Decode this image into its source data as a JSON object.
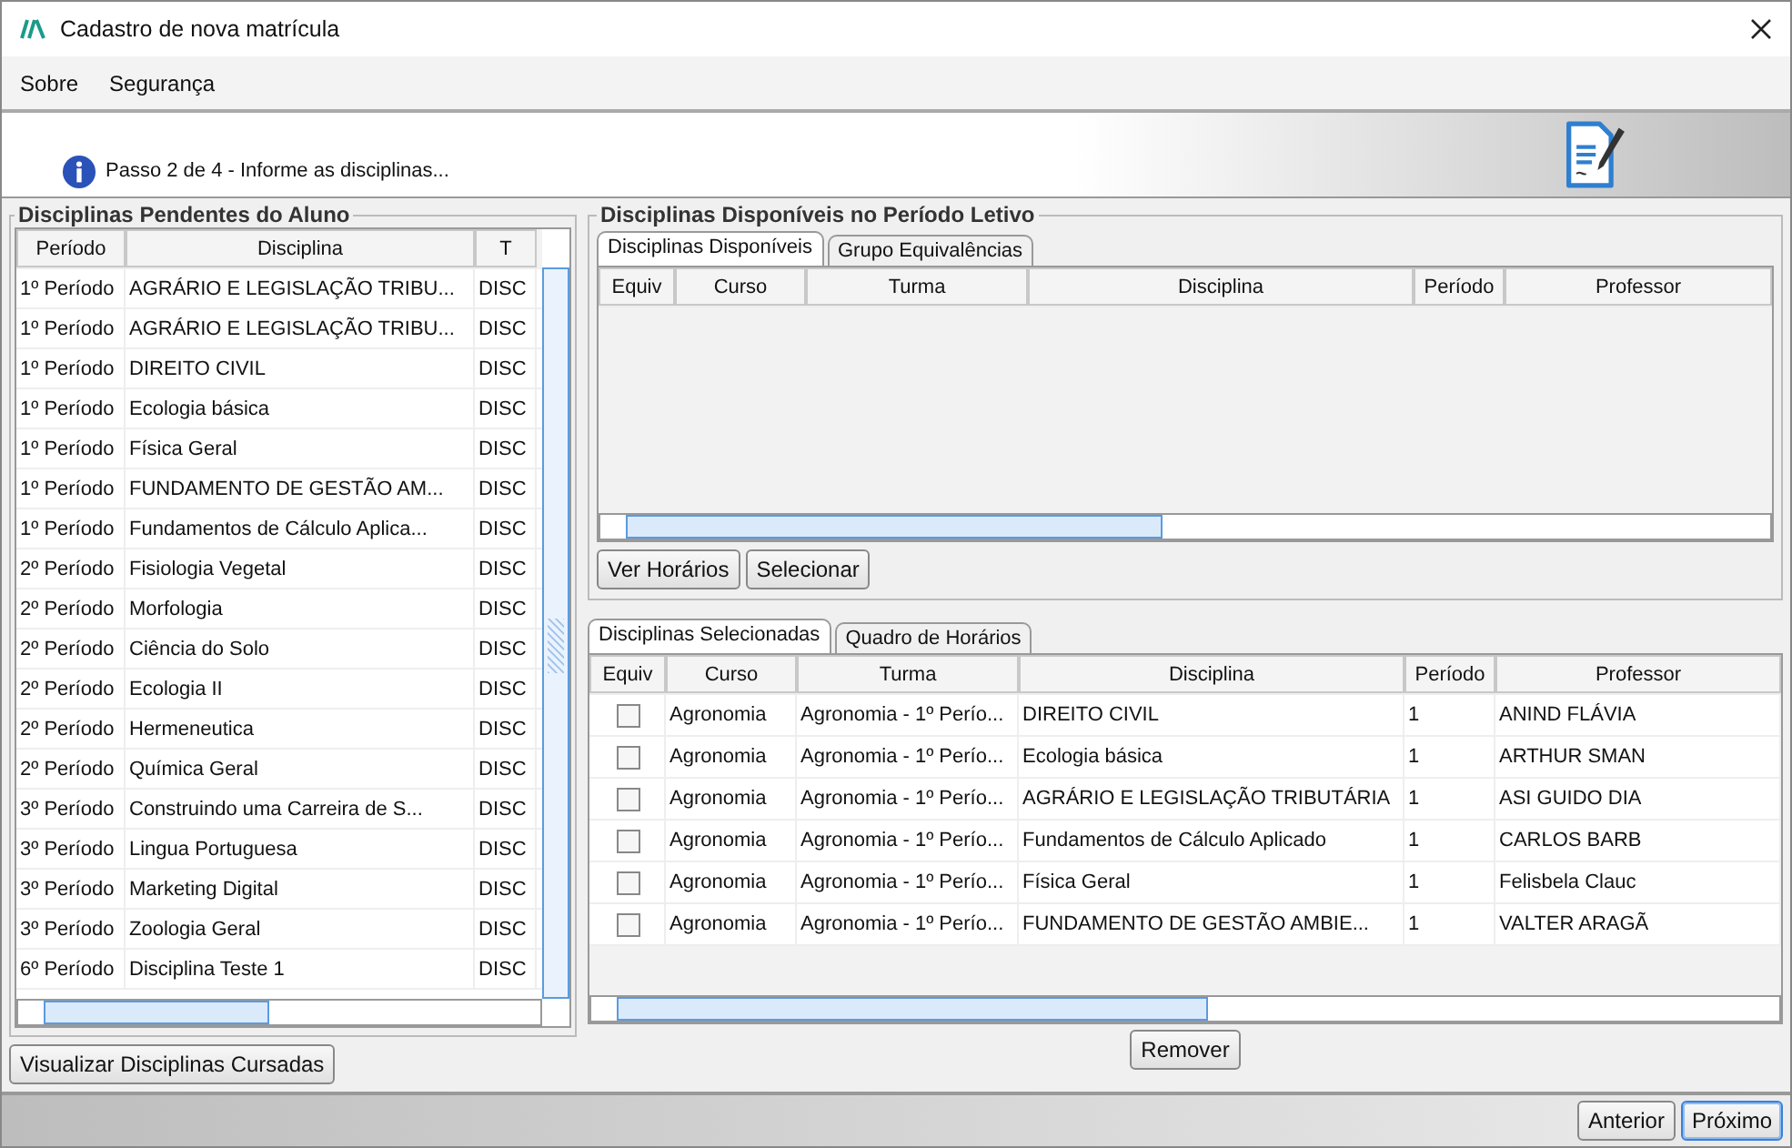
{
  "window": {
    "title": "Cadastro de nova matrícula"
  },
  "menu": [
    "Sobre",
    "Segurança"
  ],
  "step": {
    "text": "Passo 2 de 4 - Informe as disciplinas..."
  },
  "pending": {
    "title": "Disciplinas Pendentes do Aluno",
    "columns": [
      "Período",
      "Disciplina",
      "T"
    ],
    "rows": [
      [
        "1º Período",
        "AGRÁRIO E LEGISLAÇÃO TRIBU...",
        "DISC"
      ],
      [
        "1º Período",
        "AGRÁRIO E LEGISLAÇÃO TRIBU...",
        "DISC"
      ],
      [
        "1º Período",
        "DIREITO CIVIL",
        "DISC"
      ],
      [
        "1º Período",
        "Ecologia básica",
        "DISC"
      ],
      [
        "1º Período",
        "Física Geral",
        "DISC"
      ],
      [
        "1º Período",
        "FUNDAMENTO DE GESTÃO AM...",
        "DISC"
      ],
      [
        "1º Período",
        "Fundamentos de Cálculo Aplica...",
        "DISC"
      ],
      [
        "2º Período",
        "Fisiologia Vegetal",
        "DISC"
      ],
      [
        "2º Período",
        "Morfologia",
        "DISC"
      ],
      [
        "2º Período",
        "Ciência do Solo",
        "DISC"
      ],
      [
        "2º Período",
        "Ecologia II",
        "DISC"
      ],
      [
        "2º Período",
        "Hermeneutica",
        "DISC"
      ],
      [
        "2º Período",
        "Química Geral",
        "DISC"
      ],
      [
        "3º Período",
        "Construindo uma Carreira de S...",
        "DISC"
      ],
      [
        "3º Período",
        "Lingua Portuguesa",
        "DISC"
      ],
      [
        "3º Período",
        "Marketing Digital",
        "DISC"
      ],
      [
        "3º Período",
        "Zoologia Geral",
        "DISC"
      ],
      [
        "6º Período",
        "Disciplina Teste 1",
        "DISC"
      ]
    ],
    "button": "Visualizar Disciplinas Cursadas"
  },
  "available": {
    "title": "Disciplinas Disponíveis no Período Letivo",
    "tabs": [
      {
        "label": "Disciplinas Disponíveis",
        "selected": true
      },
      {
        "label": "Grupo Equivalências",
        "selected": false
      }
    ],
    "columns": [
      "Equiv",
      "Curso",
      "Turma",
      "Disciplina",
      "Período",
      "Professor"
    ],
    "buttons": [
      "Ver Horários",
      "Selecionar"
    ]
  },
  "selected_list": {
    "tabs": [
      {
        "label": "Disciplinas Selecionadas",
        "selected": true
      },
      {
        "label": "Quadro de Horários",
        "selected": false
      }
    ],
    "columns": [
      "Equiv",
      "Curso",
      "Turma",
      "Disciplina",
      "Período",
      "Professor"
    ],
    "rows": [
      {
        "checked": false,
        "cells": [
          "",
          "Agronomia",
          "Agronomia - 1º Perío...",
          "DIREITO CIVIL",
          "1",
          "ANIND FLÁVIA"
        ]
      },
      {
        "checked": false,
        "cells": [
          "",
          "Agronomia",
          "Agronomia - 1º Perío...",
          "Ecologia básica",
          "1",
          "ARTHUR SMAN"
        ]
      },
      {
        "checked": false,
        "cells": [
          "",
          "Agronomia",
          "Agronomia - 1º Perío...",
          "AGRÁRIO E LEGISLAÇÃO TRIBUTÁRIA",
          "1",
          "ASI GUIDO DIA"
        ]
      },
      {
        "checked": false,
        "cells": [
          "",
          "Agronomia",
          "Agronomia - 1º Perío...",
          "Fundamentos de Cálculo Aplicado",
          "1",
          "CARLOS BARB"
        ]
      },
      {
        "checked": false,
        "cells": [
          "",
          "Agronomia",
          "Agronomia - 1º Perío...",
          "Física Geral",
          "1",
          "Felisbela Clauc"
        ]
      },
      {
        "checked": false,
        "cells": [
          "",
          "Agronomia",
          "Agronomia - 1º Perío...",
          "FUNDAMENTO DE GESTÃO AMBIE...",
          "1",
          "VALTER ARAGÃ"
        ]
      }
    ],
    "button": "Remover"
  },
  "footer": {
    "buttons": [
      {
        "label": "Anterior",
        "selected": false
      },
      {
        "label": "Próximo",
        "selected": true
      }
    ]
  }
}
